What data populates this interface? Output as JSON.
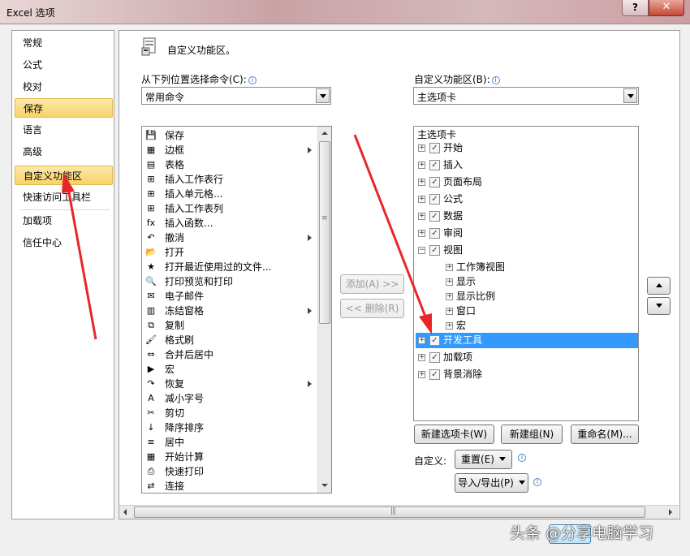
{
  "window": {
    "title": "Excel 选项",
    "help": "?",
    "close": "✕"
  },
  "categories": [
    {
      "label": "常规"
    },
    {
      "label": "公式"
    },
    {
      "label": "校对"
    },
    {
      "label": "保存"
    },
    {
      "label": "语言"
    },
    {
      "label": "高级"
    },
    {
      "label": "自定义功能区"
    },
    {
      "label": "快速访问工具栏"
    },
    {
      "label": "加载项"
    },
    {
      "label": "信任中心"
    }
  ],
  "header": {
    "title": "自定义功能区。"
  },
  "left": {
    "label": "从下列位置选择命令(C):",
    "combo_value": "常用命令",
    "commands": [
      {
        "label": "保存",
        "icon": "💾"
      },
      {
        "label": "边框",
        "icon": "▦"
      },
      {
        "label": "表格",
        "icon": "▤"
      },
      {
        "label": "插入工作表行",
        "icon": "⊞"
      },
      {
        "label": "插入单元格...",
        "icon": "⊞"
      },
      {
        "label": "插入工作表列",
        "icon": "⊞"
      },
      {
        "label": "插入函数...",
        "icon": "fx"
      },
      {
        "label": "撤消",
        "icon": "↶"
      },
      {
        "label": "打开",
        "icon": "📂"
      },
      {
        "label": "打开最近使用过的文件...",
        "icon": "★"
      },
      {
        "label": "打印预览和打印",
        "icon": "🔍"
      },
      {
        "label": "电子邮件",
        "icon": "✉"
      },
      {
        "label": "冻结窗格",
        "icon": "▥"
      },
      {
        "label": "复制",
        "icon": "⧉"
      },
      {
        "label": "格式刷",
        "icon": "🖌"
      },
      {
        "label": "合并后居中",
        "icon": "⇔"
      },
      {
        "label": "宏",
        "icon": "▶"
      },
      {
        "label": "恢复",
        "icon": "↷"
      },
      {
        "label": "减小字号",
        "icon": "A"
      },
      {
        "label": "剪切",
        "icon": "✂"
      },
      {
        "label": "降序排序",
        "icon": "↓"
      },
      {
        "label": "居中",
        "icon": "≡"
      },
      {
        "label": "开始计算",
        "icon": "▦"
      },
      {
        "label": "快速打印",
        "icon": "⎙"
      },
      {
        "label": "连接",
        "icon": "⇄"
      }
    ]
  },
  "middle": {
    "add": "添加(A) >>",
    "remove": "<< 删除(R)"
  },
  "right": {
    "label": "自定义功能区(B):",
    "combo_value": "主选项卡",
    "tree_header": "主选项卡",
    "tabs": [
      {
        "label": "开始"
      },
      {
        "label": "插入"
      },
      {
        "label": "页面布局"
      },
      {
        "label": "公式"
      },
      {
        "label": "数据"
      },
      {
        "label": "审阅"
      },
      {
        "label": "视图"
      }
    ],
    "view_groups": [
      {
        "label": "工作簿视图"
      },
      {
        "label": "显示"
      },
      {
        "label": "显示比例"
      },
      {
        "label": "窗口"
      },
      {
        "label": "宏"
      }
    ],
    "tabs_after": [
      {
        "label": "开发工具"
      },
      {
        "label": "加载项"
      },
      {
        "label": "背景消除"
      }
    ],
    "new_tab": "新建选项卡(W)",
    "new_group": "新建组(N)",
    "rename": "重命名(M)...",
    "customize_label": "自定义:",
    "reset": "重置(E)",
    "import_export": "导入/导出(P)"
  },
  "watermark": "头条 @分享电脑学习"
}
